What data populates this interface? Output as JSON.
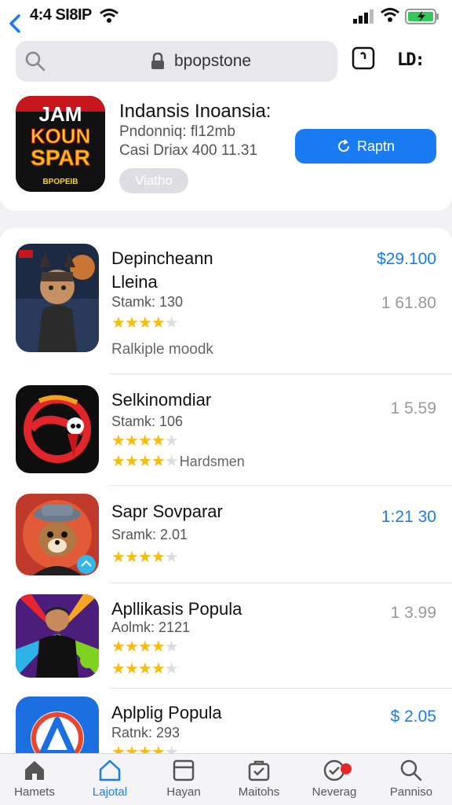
{
  "status_bar": {
    "time": "4:4 SI8IP"
  },
  "header": {
    "search_text": "bpopstone",
    "tabs_text": "LD:"
  },
  "featured": {
    "title": "Indansis Inoansia:",
    "line1": "Pndonniq: fl12mb",
    "line2": "Casi Driaх 400 11.31",
    "badge": "Viatho",
    "button_label": "Raptn",
    "icon_text": {
      "line1": "JAM",
      "line2": "KOUN",
      "line3": "SPAR",
      "line4": "BPOPEIB"
    }
  },
  "apps": [
    {
      "title": "Depincheann Lleina",
      "meta": "Stamk: 130",
      "rating": 3.5,
      "extra": "Ralkiple moodk",
      "price": "$29.100",
      "price_color": "blue",
      "price2": "1 61.80"
    },
    {
      "title": "Selkinomdiar",
      "meta": "Stamk: 106",
      "rating": 3.5,
      "rating2": 4,
      "rating2_label": "Hardsmen",
      "price": "1 5.59",
      "price_color": "gray"
    },
    {
      "title": "Sapr Sovparar",
      "meta": "Sramk: 2.01",
      "rating": 4,
      "price": "1:21 30",
      "price_color": "blue"
    },
    {
      "title": "Apllikasis Popula",
      "meta": "Aolmk: 2121",
      "rating": 3.5,
      "rating2": 4,
      "price": "1 3.99",
      "price_color": "gray"
    },
    {
      "title": "Aplplig Popula",
      "meta": "Ratnk: 293",
      "rating": 3.5,
      "price": "$ 2.05",
      "price_color": "blue"
    }
  ],
  "tabs": [
    {
      "label": "Hamets",
      "icon": "house-icon"
    },
    {
      "label": "Lajotal",
      "icon": "house-outline-icon",
      "active": true
    },
    {
      "label": "Hayan",
      "icon": "document-icon"
    },
    {
      "label": "Maitohs",
      "icon": "bag-check-icon"
    },
    {
      "label": "Neverag",
      "icon": "check-circle-icon",
      "badge": true
    },
    {
      "label": "Panniso",
      "icon": "search-icon"
    }
  ],
  "colors": {
    "accent": "#1a7cf2",
    "star": "#f5bd12",
    "badge_red": "#e52727"
  }
}
